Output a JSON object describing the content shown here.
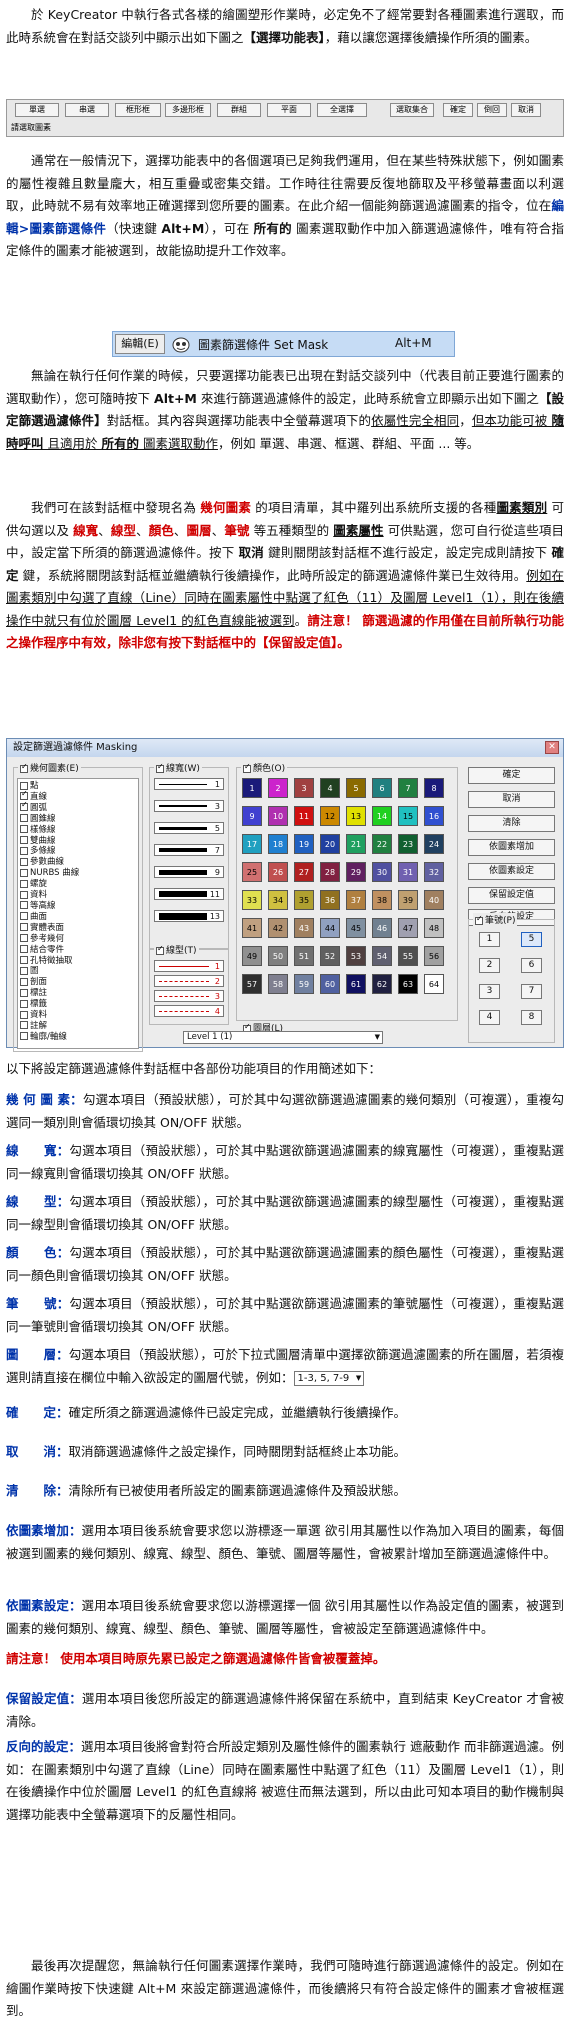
{
  "p1": {
    "a": "於 KeyCreator 中執行各式各樣的繪圖塑形作業時，必定免不了經常要對各種圖素進行選取，而此時系統會在對話交談列中顯示出如下圖之",
    "b": "【選擇功能表】",
    "c": "，藉以讓您選擇後續操作所須的圖素。"
  },
  "toolbar": {
    "buttons": [
      "單選",
      "串選",
      "框形框",
      "多邊形框",
      "群組",
      "平面",
      "全選擇"
    ],
    "right_buttons": [
      "選取集合",
      "確定",
      "倒回",
      "取消"
    ],
    "status": "請選取圖素"
  },
  "p2": {
    "a": "通常在一般情況下，選擇功能表中的各個選項已足夠我們運用，但在某些特殊狀態下，例如圖素的屬性複雜且數量龐大，相互重疊或密集交錯。工作時往往需要反復地篩取及平移螢幕畫面以利選取，此時就不易有效率地正確選擇到您所要的圖素。在此介紹一個能夠篩選過濾圖素的指令，位在",
    "b": "編輯>圖素篩選條件",
    "c": "（快速鍵 ",
    "d": "Alt+M",
    "e": "），可在 ",
    "f": "所有的",
    "g": " 圖素選取動作中加入篩選過濾條件，唯有符合指定條件的圖素才能被選到，故能協助提升工作效率。"
  },
  "menu": {
    "edit": "編輯(E)",
    "label": "圖素篩選條件 Set Mask",
    "shortcut": "Alt+M",
    "icon": "mask-filter-icon"
  },
  "p3": {
    "a": "無論在執行任何作業的時候，只要選擇功能表已出現在對話交談列中（代表目前正要進行圖素的選取動作），您可隨時按下 ",
    "b": "Alt+M",
    "c": " 來進行篩選過濾條件的設定，此時系統會立即顯示出如下圖之",
    "d": "【設定篩選過濾條件】",
    "e": "對話框。其內容與選擇功能表中全螢幕選項下的",
    "f": "依屬性完全相同",
    "g": "，",
    "h": "但本功能可被 ",
    "i": "隨時呼叫",
    "j": " 且適用於 ",
    "k": "所有的",
    "l": " 圖素選取動作",
    "m": "，例如 單選、串選、框選、群組、平面 ... 等。"
  },
  "p4": {
    "a": "我們可在該對話框中發現名為 ",
    "b": "幾何圖素",
    "c": " 的項目清單，其中羅列出系統所支援的各種",
    "d": "圖素類別",
    "e": " 可供勾選以及 ",
    "f": "線寬",
    "g": "、",
    "h": "線型",
    "i": "、",
    "j": "顏色",
    "k": "、",
    "l": "圖層",
    "m": "、",
    "n": "筆號",
    "o": " 等五種類型的 ",
    "p": "圖素屬性",
    "q": " 可供點選，您可自行從這些項目中，設定當下所須的篩選過濾條件。按下 ",
    "r": "取消",
    "s": " 鍵則關閉該對話框不進行設定，設定完成則請按下 ",
    "t": "確定",
    "u": " 鍵，系統將關閉該對話框並繼續執行後續操作，此時所設定的篩選過濾條件業已生效待用。",
    "v": "例如在圖素類別中勾選了直線（Line）同時在圖素屬性中點選了紅色（11）及圖層 Level1（1），則在後續操作中就只有位於圖層 Level1 的紅色直線能被選到",
    "w": "。",
    "x": "請注意！ 篩選過濾的作用僅在目前所執行功能之操作程序中有效，除非您有按下對話框中的【保留設定值】。"
  },
  "dialog": {
    "title": "設定篩選過濾條件 Masking",
    "geo_title": "幾何圖素(E)",
    "entities": [
      "點",
      "直線",
      "圓弧",
      "圓錐線",
      "樣條線",
      "雙曲線",
      "多條線",
      "參數曲線",
      "NURBS 曲線",
      "螺旋",
      "資料",
      "等高線",
      "曲面",
      "實體表面",
      "參考幾何",
      "結合零件",
      "孔特徵抽取",
      "圖",
      "剖面",
      "標註",
      "標籤",
      "資料",
      "註解",
      "輪廓/軸線"
    ],
    "entities_checked": [
      1,
      2
    ],
    "width_title": "線寬(W)",
    "width_numbers": [
      "1",
      "3",
      "5",
      "7",
      "9",
      "11",
      "13"
    ],
    "type_title": "線型(T)",
    "type_numbers": [
      "1",
      "2",
      "3",
      "4"
    ],
    "color_title": "顏色(O)",
    "colors": [
      "1",
      "2",
      "3",
      "4",
      "5",
      "6",
      "7",
      "8",
      "9",
      "10",
      "11",
      "12",
      "13",
      "14",
      "15",
      "16",
      "17",
      "18",
      "19",
      "20",
      "21",
      "22",
      "23",
      "24",
      "25",
      "26",
      "27",
      "28",
      "29",
      "30",
      "31",
      "32",
      "33",
      "34",
      "35",
      "36",
      "37",
      "38",
      "39",
      "40",
      "41",
      "42",
      "43",
      "44",
      "45",
      "46",
      "47",
      "48",
      "49",
      "50",
      "51",
      "52",
      "53",
      "54",
      "55",
      "56",
      "57",
      "58",
      "59",
      "60",
      "61",
      "62",
      "63",
      "64"
    ],
    "color_hex": [
      "#1a1a7a",
      "#cc22cc",
      "#a04040",
      "#204020",
      "#8a6a00",
      "#208080",
      "#208040",
      "#1a1a7a",
      "#4040d0",
      "#b030b0",
      "#d01010",
      "#cc8800",
      "#e0e000",
      "#20d020",
      "#20c0c0",
      "#3050d0",
      "#20a0c0",
      "#2080d0",
      "#2060c0",
      "#2040a0",
      "#20a060",
      "#208040",
      "#106030",
      "#204060",
      "#d07070",
      "#c05050",
      "#b02020",
      "#802040",
      "#602060",
      "#5050a0",
      "#7060b0",
      "#6060a0",
      "#e0e050",
      "#d0c040",
      "#b0a030",
      "#907020",
      "#b08040",
      "#c09060",
      "#c0a070",
      "#a08060",
      "#c0a080",
      "#b09070",
      "#a08060",
      "#90a0c0",
      "#8090a0",
      "#708090",
      "#a0a0b0",
      "#c0c0c0",
      "#909090",
      "#808080",
      "#707070",
      "#606060",
      "#504040",
      "#606070",
      "#505050",
      "#a0a0a0",
      "#303030",
      "#808090",
      "#7080a0",
      "#5060a0",
      "#101060",
      "#202040",
      "#000000",
      "#ffffff"
    ],
    "layer_title": "圖層(L)",
    "layer_value": "Level 1 (1)",
    "pen_title": "筆號(P)",
    "pens": [
      "1",
      "5",
      "2",
      "6",
      "3",
      "7",
      "4",
      "8"
    ],
    "buttons": [
      "確定",
      "取消",
      "清除",
      "依圖素增加",
      "依圖素設定",
      "保留設定值",
      "反向的設定"
    ]
  },
  "intro": "以下將設定篩選過濾條件對話框中各部份功能項目的作用簡述如下：",
  "items": [
    {
      "k": "幾 何 圖 素：",
      "t": "勾選本項目（預設狀態），可於其中勾選欲篩選過濾圖素的幾何類別（可複選），重複勾選同一類別則會循環切換其 ON/OFF 狀態。"
    },
    {
      "k": "線　　寬：",
      "t": "勾選本項目（預設狀態），可於其中點選欲篩選過濾圖素的線寬屬性（可複選），重複點選同一線寬則會循環切換其 ON/OFF 狀態。"
    },
    {
      "k": "線　　型：",
      "t": "勾選本項目（預設狀態），可於其中點選欲篩選過濾圖素的線型屬性（可複選），重複點選同一線型則會循環切換其 ON/OFF 狀態。"
    },
    {
      "k": "顏　　色：",
      "t": "勾選本項目（預設狀態），可於其中點選欲篩選過濾圖素的顏色屬性（可複選），重複點選同一顏色則會循環切換其 ON/OFF 狀態。"
    },
    {
      "k": "筆　　號：",
      "t": "勾選本項目（預設狀態），可於其中點選欲篩選過濾圖素的筆號屬性（可複選），重複點選同一筆號則會循環切換其 ON/OFF 狀態。"
    },
    {
      "k": "圖　　層：",
      "t": "勾選本項目（預設狀態），可於下拉式圖層清單中選擇欲篩選過濾圖素的所在圖層，若須複選則請直接在欄位中輸入欲設定的圖層代號，例如：",
      "sel": "1-3, 5, 7-9"
    },
    {
      "k": "確　　定：",
      "t": "確定所須之篩選過濾條件已設定完成，並繼續執行後續操作。"
    },
    {
      "k": "取　　消：",
      "t": "取消篩選過濾條件之設定操作，同時關閉對話框終止本功能。"
    },
    {
      "k": "清　　除：",
      "t": "清除所有已被使用者所設定的圖素篩選過濾條件及預設狀態。"
    },
    {
      "k": "依圖素增加：",
      "t": "選用本項目後系統會要求您以游標逐一單選 欲引用其屬性以作為加入項目的圖素，每個被選到圖素的幾何類別、線寬、線型、顏色、筆號、圖層等屬性，會被累計增加至篩選過濾條件中。"
    },
    {
      "k": "依圖素設定：",
      "t": "選用本項目後系統會要求您以游標選擇一個 欲引用其屬性以作為設定值的圖素，被選到圖素的幾何類別、線寬、線型、顏色、筆號、圖層等屬性，會被設定至篩選過濾條件中。"
    },
    {
      "k": "",
      "t": "請注意！ 使用本項目時原先累已設定之篩選過濾條件皆會被覆蓋掉。"
    },
    {
      "k": "保留設定值：",
      "t": "選用本項目後您所設定的篩選過濾條件將保留在系統中，直到結束 KeyCreator 才會被清除。"
    },
    {
      "k": "反向的設定：",
      "t": "選用本項目後將會對符合所設定類別及屬性條件的圖素執行 遮蔽動作 而非篩選過濾。例如：在圖素類別中勾選了直線（Line）同時在圖素屬性中點選了紅色（11）及圖層 Level1（1），則在後續操作中位於圖層 Level1 的紅色直線將 被遮住而無法選到，所以由此可知本項目的動作機制與選擇功能表中全螢幕選項下的反屬性相同。"
    }
  ],
  "final": "最後再次提醒您，無論執行任何圖素選擇作業時，我們可隨時進行篩選過濾條件的設定。例如在繪圖作業時按下快速鍵 Alt+M 來設定篩選過濾條件，而後續將只有符合設定條件的圖素才會被框選到。"
}
